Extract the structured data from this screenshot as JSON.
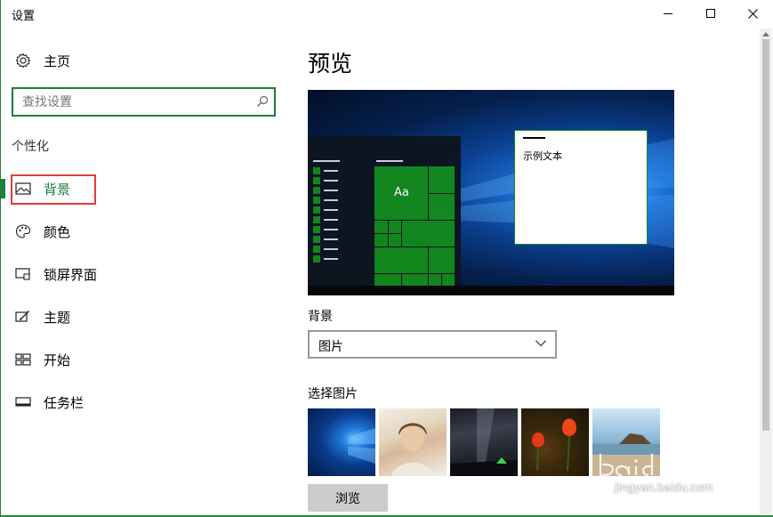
{
  "window": {
    "title": "设置"
  },
  "sidebar": {
    "home_label": "主页",
    "search_placeholder": "查找设置",
    "section_heading": "个性化",
    "items": [
      {
        "label": "背景",
        "icon": "picture-icon",
        "selected": true
      },
      {
        "label": "颜色",
        "icon": "palette-icon"
      },
      {
        "label": "锁屏界面",
        "icon": "lock-screen-icon"
      },
      {
        "label": "主题",
        "icon": "theme-icon"
      },
      {
        "label": "开始",
        "icon": "start-icon"
      },
      {
        "label": "任务栏",
        "icon": "taskbar-icon"
      }
    ]
  },
  "main": {
    "title": "预览",
    "preview": {
      "tile_label": "Aa",
      "sample_text": "示例文本"
    },
    "background_label": "背景",
    "background_select": "图片",
    "choose_picture_label": "选择图片",
    "browse_label": "浏览"
  },
  "watermark": {
    "text": "jingyan.baidu.com"
  },
  "colors": {
    "accent": "#1e7d3a",
    "tile": "#138a1c",
    "highlight": "#e23c3c"
  }
}
